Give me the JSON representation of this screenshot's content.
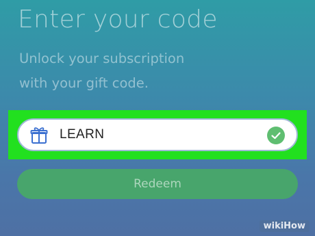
{
  "header": {
    "title": "Enter your code",
    "subtitle_line1": "Unlock your subscription",
    "subtitle_line2": "with your gift code."
  },
  "code_field": {
    "value": "LEARN",
    "leading_icon": "gift-icon",
    "trailing_icon": "check-circle-icon",
    "valid": true
  },
  "redeem_button": {
    "label": "Redeem"
  },
  "highlight": {
    "color": "#22e01f"
  },
  "colors": {
    "check": "#5fbe71",
    "button": "#48a56c",
    "gift_icon": "#3a6fd0"
  },
  "watermark": {
    "text": "wikiHow"
  }
}
